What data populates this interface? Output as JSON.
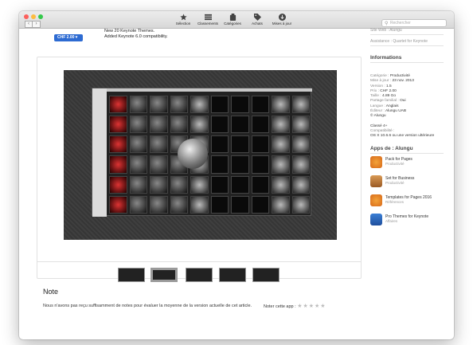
{
  "toolbar": {
    "tabs": [
      {
        "label": "Sélection",
        "icon": "star-icon"
      },
      {
        "label": "Classements",
        "icon": "list-icon"
      },
      {
        "label": "Catégories",
        "icon": "box-icon"
      },
      {
        "label": "Achats",
        "icon": "tag-icon"
      },
      {
        "label": "Mises à jour",
        "icon": "download-icon"
      }
    ],
    "search_placeholder": "Rechercher"
  },
  "release": {
    "version_button": "CHF 2.00",
    "notes": [
      "New 20 Keynote Themes.",
      "Added Keynote 6.0 compatibility."
    ]
  },
  "sidebar_links": [
    "Site Web : Alungu",
    "Assistance : Quartet for Keynote"
  ],
  "informations": {
    "title": "Informations",
    "rows": [
      {
        "label": "Catégorie :",
        "value": "Productivité"
      },
      {
        "label": "Mise à jour :",
        "value": "23 nov. 2013"
      },
      {
        "label": "Version :",
        "value": "1.5"
      },
      {
        "label": "Prix :",
        "value": "CHF 2.00"
      },
      {
        "label": "Taille :",
        "value": "4.89 Go"
      },
      {
        "label": "Partage familial :",
        "value": "Oui"
      },
      {
        "label": "Langue :",
        "value": "Anglais"
      },
      {
        "label": "Éditeur :",
        "value": "Alungu UAB"
      }
    ],
    "copyright": "© Alungu",
    "rating": "Classé 4+",
    "compat_label": "Compatibilité :",
    "compat_value": "OS X 10.6.6 ou une version ultérieure"
  },
  "more_apps": {
    "title": "Apps de : Alungu",
    "apps": [
      {
        "name": "Pack for Pages",
        "category": "Productivité"
      },
      {
        "name": "Set for Business",
        "category": "Productivité"
      },
      {
        "name": "Templates for Pages 2016",
        "category": "Références"
      },
      {
        "name": "Pro Themes for Keynote",
        "category": "Affaires"
      }
    ]
  },
  "note": {
    "title": "Note",
    "text": "Nous n'avons pas reçu suffisamment de notes pour évaluer la moyenne de la version actuelle de cet article.",
    "rate_label": "Noter cette app :",
    "stars": "★★★★★"
  },
  "colors": {
    "accent": "#2d6bd2",
    "close": "#fc605c",
    "minimize": "#fdbc40",
    "zoom": "#34c84a"
  }
}
